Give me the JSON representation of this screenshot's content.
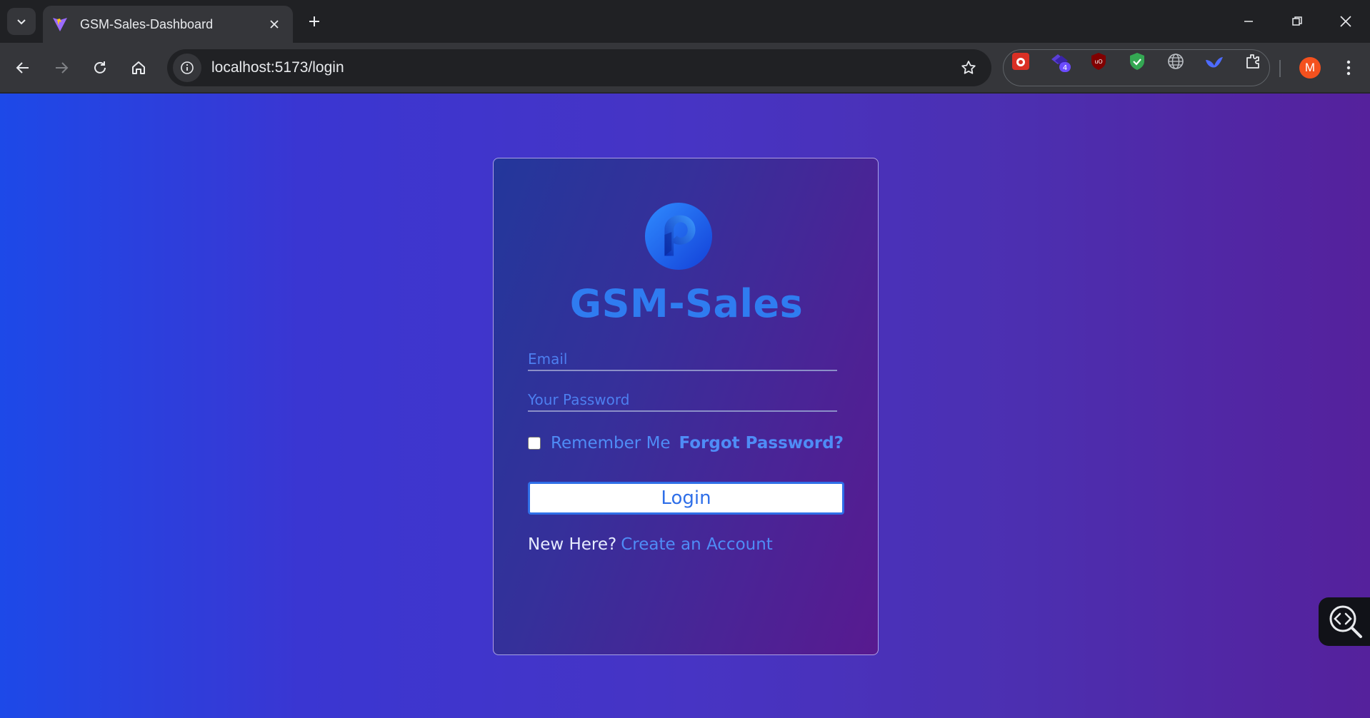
{
  "browser": {
    "tab_title": "GSM-Sales-Dashboard",
    "url": "localhost:5173/login",
    "extensions": [
      "bug-icon",
      "puzzle-badge-icon",
      "ublock-icon",
      "shield-check-icon",
      "globe-icon",
      "bird-icon",
      "extensions-icon"
    ],
    "extension_badge": "4",
    "profile_initial": "M"
  },
  "login": {
    "brand": "GSM-Sales",
    "email_placeholder": "Email",
    "password_placeholder": "Your Password",
    "remember_label": "Remember Me",
    "remember_checked": false,
    "forgot_label": "Forgot Password?",
    "login_label": "Login",
    "signup_prompt": "New Here?",
    "signup_link": "Create an Account"
  },
  "colors": {
    "accent": "#2f7cf0",
    "link": "#4f8cf6",
    "bg_left": "#1d49e8",
    "bg_right": "#55219c"
  }
}
